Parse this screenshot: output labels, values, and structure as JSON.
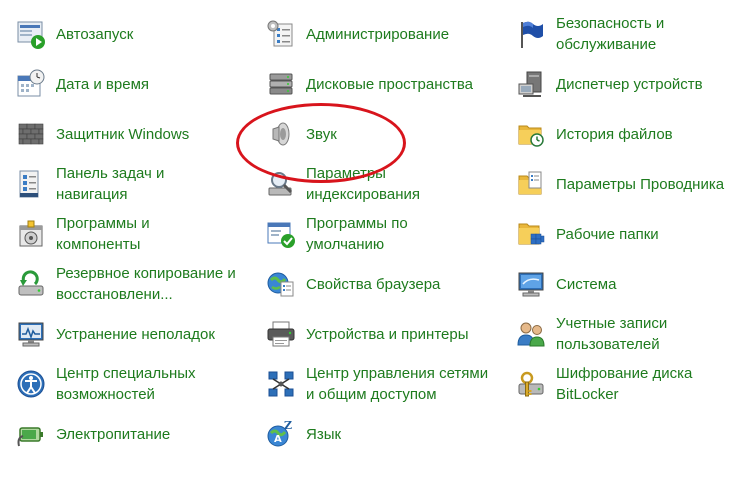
{
  "items": [
    {
      "label": "Автозапуск",
      "icon": "autoplay-icon"
    },
    {
      "label": "Администрирование",
      "icon": "administrative-tools-icon"
    },
    {
      "label": "Безопасность и\nобслуживание",
      "icon": "security-maintenance-flag-icon"
    },
    {
      "label": "Дата и время",
      "icon": "date-time-icon"
    },
    {
      "label": "Дисковые пространства",
      "icon": "storage-spaces-icon"
    },
    {
      "label": "Диспетчер устройств",
      "icon": "device-manager-icon"
    },
    {
      "label": "Защитник Windows",
      "icon": "windows-defender-wall-icon"
    },
    {
      "label": "Звук",
      "icon": "speaker-icon"
    },
    {
      "label": "История файлов",
      "icon": "file-history-icon"
    },
    {
      "label": "Панель задач и\nнавигация",
      "icon": "taskbar-navigation-icon"
    },
    {
      "label": "Параметры\nиндексирования",
      "icon": "indexing-options-icon"
    },
    {
      "label": "Параметры Проводника",
      "icon": "explorer-options-icon"
    },
    {
      "label": "Программы и\nкомпоненты",
      "icon": "programs-features-icon"
    },
    {
      "label": "Программы по\nумолчанию",
      "icon": "default-programs-icon"
    },
    {
      "label": "Рабочие папки",
      "icon": "work-folders-icon"
    },
    {
      "label": "Резервное копирование и\nвосстановлени...",
      "icon": "backup-restore-icon"
    },
    {
      "label": "Свойства браузера",
      "icon": "internet-options-icon"
    },
    {
      "label": "Система",
      "icon": "system-icon"
    },
    {
      "label": "Устранение неполадок",
      "icon": "troubleshooting-icon"
    },
    {
      "label": "Устройства и принтеры",
      "icon": "devices-printers-icon"
    },
    {
      "label": "Учетные записи\nпользователей",
      "icon": "user-accounts-icon"
    },
    {
      "label": "Центр специальных\nвозможностей",
      "icon": "ease-of-access-icon"
    },
    {
      "label": "Центр управления сетями\nи общим доступом",
      "icon": "network-sharing-icon"
    },
    {
      "label": "Шифрование диска\nBitLocker",
      "icon": "bitlocker-icon"
    },
    {
      "label": "Электропитание",
      "icon": "power-options-icon"
    },
    {
      "label": "Язык",
      "icon": "language-icon"
    }
  ],
  "colors": {
    "link_text": "#1e7b1e",
    "highlight": "#d8141c"
  }
}
